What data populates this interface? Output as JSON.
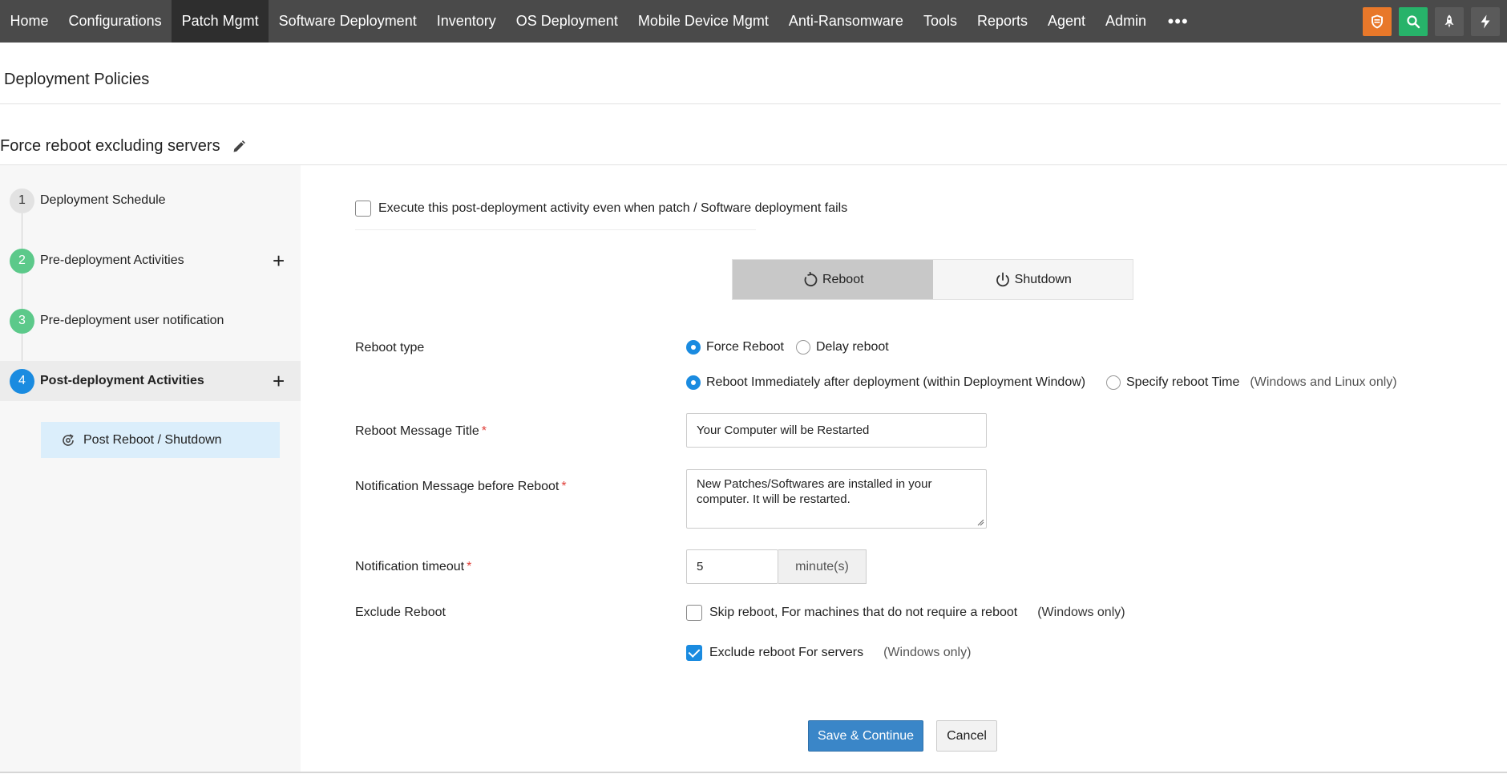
{
  "nav": {
    "items": [
      {
        "label": "Home"
      },
      {
        "label": "Configurations"
      },
      {
        "label": "Patch Mgmt"
      },
      {
        "label": "Software Deployment"
      },
      {
        "label": "Inventory"
      },
      {
        "label": "OS Deployment"
      },
      {
        "label": "Mobile Device Mgmt"
      },
      {
        "label": "Anti-Ransomware"
      },
      {
        "label": "Tools"
      },
      {
        "label": "Reports"
      },
      {
        "label": "Agent"
      },
      {
        "label": "Admin"
      }
    ],
    "active_item": "Patch Mgmt",
    "more": "•••",
    "icons": [
      {
        "name": "shield-icon",
        "color": "#e8782a"
      },
      {
        "name": "search-icon",
        "color": "#27b36a"
      },
      {
        "name": "rocket-icon",
        "color": "#5a5a5a"
      },
      {
        "name": "bolt-icon",
        "color": "#5a5a5a"
      }
    ]
  },
  "page": {
    "title": "Deployment Policies",
    "policy_name": "Force reboot excluding servers"
  },
  "steps": [
    {
      "num": "1",
      "label": "Deployment Schedule",
      "state": "default"
    },
    {
      "num": "2",
      "label": "Pre-deployment Activities",
      "state": "done",
      "plus": "+"
    },
    {
      "num": "3",
      "label": "Pre-deployment user notification",
      "state": "done"
    },
    {
      "num": "4",
      "label": "Post-deployment Activities",
      "state": "active",
      "plus": "+"
    }
  ],
  "substep": {
    "label": "Post Reboot / Shutdown"
  },
  "form": {
    "execute_on_fail": {
      "label": "Execute this post-deployment activity even when patch / Software deployment fails",
      "checked": false
    },
    "segment": {
      "reboot": "Reboot",
      "shutdown": "Shutdown",
      "selected": "Reboot"
    },
    "reboot_type": {
      "label": "Reboot type",
      "force": "Force Reboot",
      "delay": "Delay reboot",
      "selected": "Force Reboot",
      "immediate": "Reboot Immediately after deployment (within Deployment Window)",
      "specify": "Specify reboot Time",
      "specify_hint": "(Windows and Linux only)",
      "timing_selected": "immediate"
    },
    "message_title": {
      "label": "Reboot Message Title",
      "required": "*",
      "value": "Your Computer will be Restarted"
    },
    "notification_message": {
      "label": "Notification Message before Reboot",
      "required": "*",
      "value": "New Patches/Softwares are installed in your computer. It will be restarted."
    },
    "notification_timeout": {
      "label": "Notification timeout",
      "required": "*",
      "value": "5",
      "unit": "minute(s)"
    },
    "exclude_reboot": {
      "label": "Exclude Reboot",
      "skip": {
        "label": "Skip reboot, For machines that do not require a reboot",
        "hint": "(Windows only)",
        "checked": false
      },
      "servers": {
        "label": "Exclude reboot For servers",
        "hint": "(Windows only)",
        "checked": true
      }
    },
    "save_label": "Save & Continue",
    "cancel_label": "Cancel"
  },
  "colors": {
    "accent": "#1a8be0",
    "done": "#5cc98a",
    "primary_button": "#3a86c8"
  }
}
